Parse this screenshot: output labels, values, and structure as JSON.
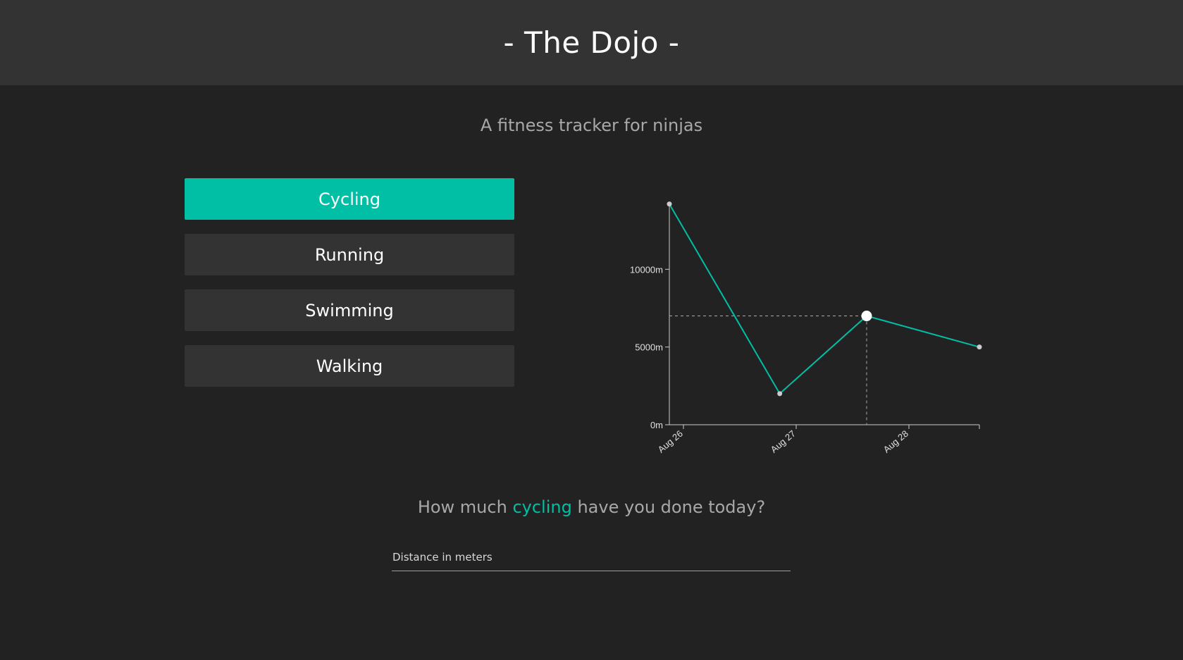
{
  "header": {
    "title": "- The Dojo -"
  },
  "subtitle": "A fitness tracker for ninjas",
  "activities": [
    {
      "label": "Cycling",
      "active": true
    },
    {
      "label": "Running",
      "active": false
    },
    {
      "label": "Swimming",
      "active": false
    },
    {
      "label": "Walking",
      "active": false
    }
  ],
  "chart_data": {
    "type": "line",
    "series": [
      {
        "points": [
          {
            "x": "2023-08-25 21:00",
            "y": 14200
          },
          {
            "x": "2023-08-26 20:30",
            "y": 2000
          },
          {
            "x": "2023-08-27 15:00",
            "y": 7000
          },
          {
            "x": "2023-08-28 15:00",
            "y": 5000
          }
        ]
      }
    ],
    "x_ticks": [
      "Aug 26",
      "Aug 27",
      "Aug 28"
    ],
    "y_ticks": [
      "0m",
      "5000m",
      "10000m"
    ],
    "highlighted_point": {
      "x": "2023-08-27 15:00",
      "y": 7000
    },
    "colors": {
      "line": "#00bfa5",
      "point": "#cccccc",
      "axis": "#cccccc"
    }
  },
  "question": {
    "prefix": "How much ",
    "activity": "cycling",
    "suffix": " have you done today?"
  },
  "distance_input": {
    "placeholder": "Distance in meters",
    "value": ""
  },
  "colors": {
    "accent": "#00bfa5",
    "background": "#222222",
    "header": "#333333"
  }
}
